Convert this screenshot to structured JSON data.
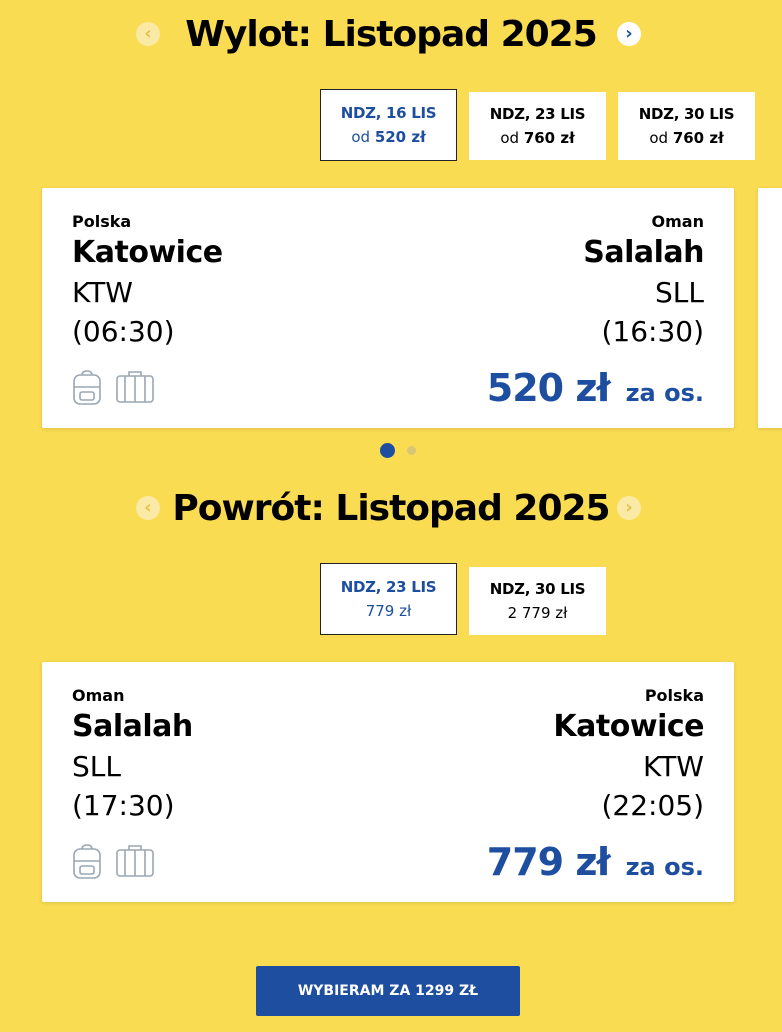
{
  "outbound": {
    "title": "Wylot: Listopad 2025",
    "prev_icon": "chevron-left-icon",
    "next_icon": "chevron-right-icon",
    "dates": [
      {
        "date": "NDZ, 16 LIS",
        "prefix": "od",
        "price": "520 zł",
        "selected": true
      },
      {
        "date": "NDZ, 23 LIS",
        "prefix": "od",
        "price": "760 zł",
        "selected": false
      },
      {
        "date": "NDZ, 30 LIS",
        "prefix": "od",
        "price": "760 zł",
        "selected": false
      }
    ],
    "flight": {
      "from_country": "Polska",
      "from_city": "Katowice",
      "from_code": "KTW",
      "from_time": "(06:30)",
      "to_country": "Oman",
      "to_city": "Salalah",
      "to_code": "SLL",
      "to_time": "(16:30)",
      "price": "520 zł",
      "per_person": "za os.",
      "icons": [
        "backpack-icon",
        "suitcase-icon"
      ]
    }
  },
  "return": {
    "title": "Powrót: Listopad 2025",
    "prev_icon": "chevron-left-icon",
    "next_icon": "chevron-right-icon",
    "dates": [
      {
        "date": "NDZ, 23 LIS",
        "price": "779 zł",
        "selected": true
      },
      {
        "date": "NDZ, 30 LIS",
        "price": "2 779 zł",
        "selected": false
      }
    ],
    "flight": {
      "from_country": "Oman",
      "from_city": "Salalah",
      "from_code": "SLL",
      "from_time": "(17:30)",
      "to_country": "Polska",
      "to_city": "Katowice",
      "to_code": "KTW",
      "to_time": "(22:05)",
      "price": "779 zł",
      "per_person": "za os.",
      "icons": [
        "backpack-icon",
        "suitcase-icon"
      ]
    }
  },
  "carousel": {
    "total": 2,
    "active": 1
  },
  "select_button": "WYBIERAM ZA 1299 ZŁ",
  "colors": {
    "background": "#f9dc52",
    "accent": "#1e4ea0",
    "card": "#ffffff"
  }
}
